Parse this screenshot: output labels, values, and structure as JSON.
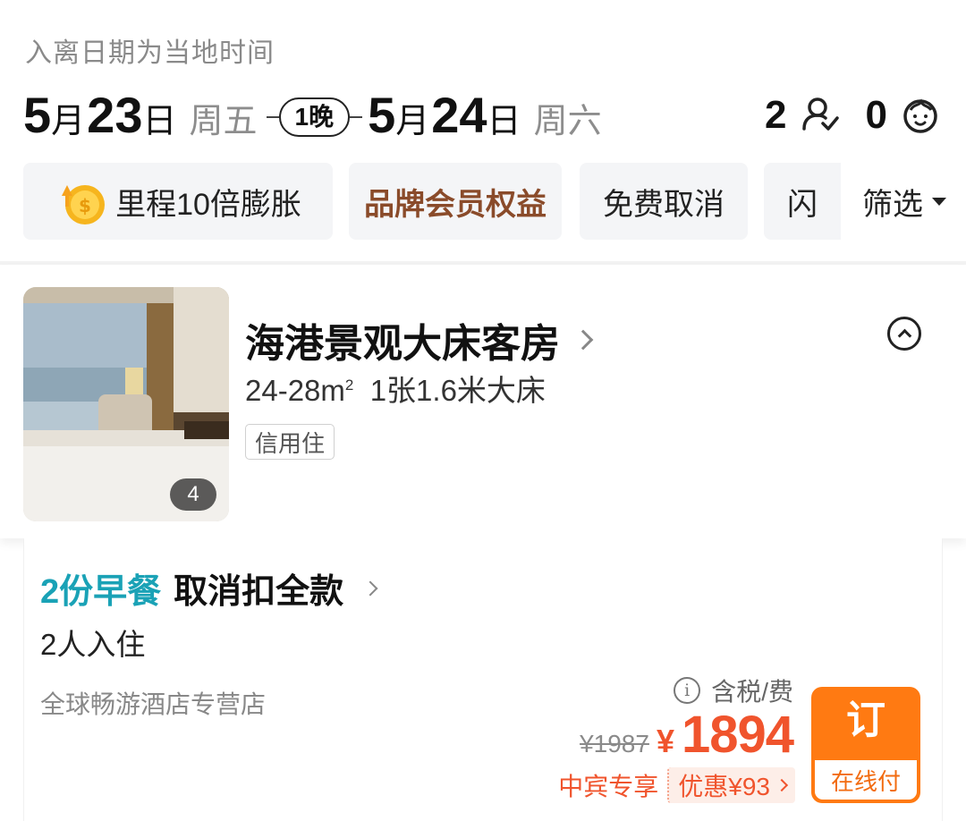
{
  "header": {
    "note": "入离日期为当地时间",
    "checkin": {
      "month": "5",
      "month_unit": "月",
      "day": "23",
      "day_unit": "日",
      "weekday": "周五"
    },
    "nights": "1晚",
    "checkout": {
      "month": "5",
      "month_unit": "月",
      "day": "24",
      "day_unit": "日",
      "weekday": "周六"
    },
    "adults": "2",
    "children": "0",
    "adult_icon": "adult-person-icon",
    "child_icon": "child-face-icon"
  },
  "filters": {
    "items": [
      {
        "label": "里程10倍膨胀",
        "icon": "gold-coin-icon"
      },
      {
        "label": "品牌会员权益"
      },
      {
        "label": "免费取消"
      },
      {
        "label": "闪"
      }
    ],
    "filter_label": "筛选"
  },
  "room": {
    "title": "海港景观大床客房",
    "area": "24-28m",
    "area_sup": "2",
    "bed": "1张1.6米大床",
    "tag": "信用住",
    "photo_count": "4"
  },
  "offer": {
    "breakfast": "2份早餐",
    "cancellation": "取消扣全款",
    "occupancy": "2人入住",
    "store": "全球畅游酒店专营店",
    "tax_note": "含税/费",
    "original_price": "¥1987",
    "currency": "¥",
    "price": "1894",
    "promo_label": "中宾专享",
    "promo_discount": "优惠¥93",
    "book_label": "订",
    "book_sub": "在线付"
  },
  "colors": {
    "accent_orange": "#ff7a12",
    "price_red": "#f0542d",
    "breakfast_teal": "#1aa2b6",
    "brand_brown": "#8a4b2a"
  }
}
